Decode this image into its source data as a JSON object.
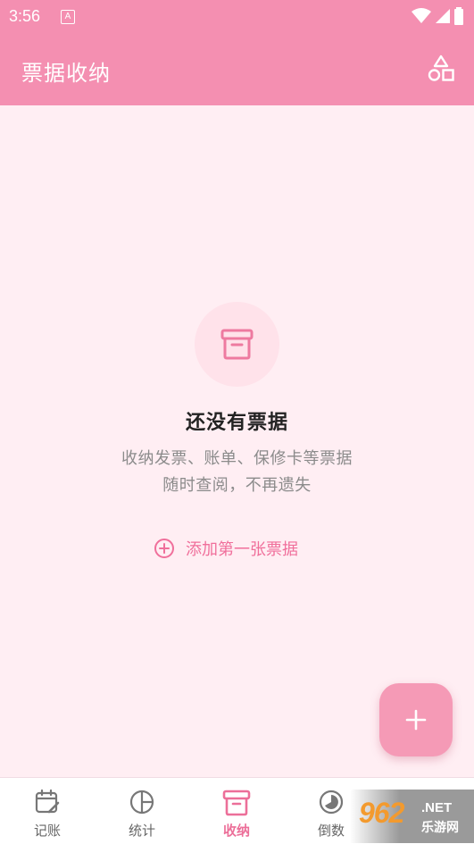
{
  "status": {
    "time": "3:56",
    "indicator": "A"
  },
  "header": {
    "title": "票据收纳",
    "action_icon": "shapes-icon"
  },
  "empty": {
    "title": "还没有票据",
    "desc_line1": "收纳发票、账单、保修卡等票据",
    "desc_line2": "随时查阅，不再遗失",
    "add_label": "添加第一张票据"
  },
  "fab": {
    "icon": "plus-icon"
  },
  "nav": {
    "items": [
      {
        "label": "记账",
        "icon": "calendar-edit-icon"
      },
      {
        "label": "统计",
        "icon": "pie-chart-icon"
      },
      {
        "label": "收纳",
        "icon": "archive-icon",
        "active": true
      },
      {
        "label": "倒数",
        "icon": "countdown-icon"
      },
      {
        "label": "",
        "icon": "user-icon"
      }
    ]
  },
  "watermark": {
    "number": "962",
    "net": ".NET",
    "site": "乐游网"
  },
  "colors": {
    "primary": "#f48fb1",
    "accent": "#ec6f99",
    "background": "#ffeef3"
  }
}
